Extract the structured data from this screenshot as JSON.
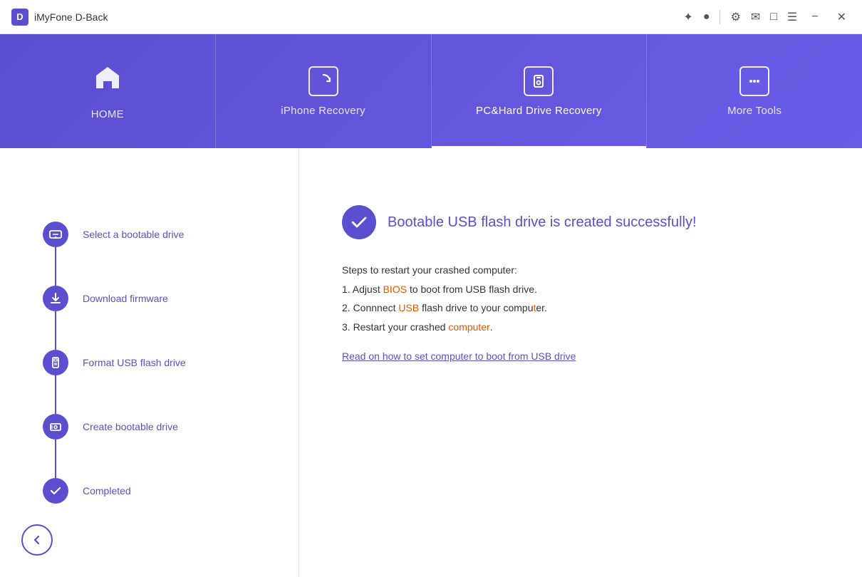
{
  "titlebar": {
    "logo": "D",
    "app_name": "iMyFone D-Back",
    "icons": [
      "share",
      "user",
      "settings",
      "mail",
      "chat",
      "menu",
      "minimize",
      "close"
    ]
  },
  "nav": {
    "items": [
      {
        "id": "home",
        "label": "HOME",
        "icon": "home",
        "active": false
      },
      {
        "id": "iphone-recovery",
        "label": "iPhone Recovery",
        "icon": "refresh",
        "active": false
      },
      {
        "id": "pc-hard-drive",
        "label": "PC&Hard Drive Recovery",
        "icon": "key",
        "active": true
      },
      {
        "id": "more-tools",
        "label": "More Tools",
        "icon": "more",
        "active": false
      }
    ]
  },
  "sidebar": {
    "steps": [
      {
        "id": "select-drive",
        "label": "Select a bootable drive",
        "icon": "download-layers"
      },
      {
        "id": "download-firmware",
        "label": "Download firmware",
        "icon": "download"
      },
      {
        "id": "format-usb",
        "label": "Format USB flash drive",
        "icon": "usb"
      },
      {
        "id": "create-bootable",
        "label": "Create bootable drive",
        "icon": "drive"
      },
      {
        "id": "completed",
        "label": "Completed",
        "icon": "check"
      }
    ],
    "back_label": "‹"
  },
  "main": {
    "success_title": "Bootable USB flash drive is created successfully!",
    "steps_intro": "Steps to restart your crashed computer:",
    "step1_pre": "1. Adjust ",
    "step1_highlight": "BIOS",
    "step1_post": " to boot from USB flash drive.",
    "step2_pre": "2. Connnect ",
    "step2_highlight": "USB",
    "step2_mid": " flash drive to your compu",
    "step2_highlight2": "t",
    "step2_post": "er.",
    "step3_pre": "3. Restart your crashed ",
    "step3_highlight": "computer",
    "step3_post": ".",
    "link_text": "Read on how to set computer to boot from USB drive"
  }
}
